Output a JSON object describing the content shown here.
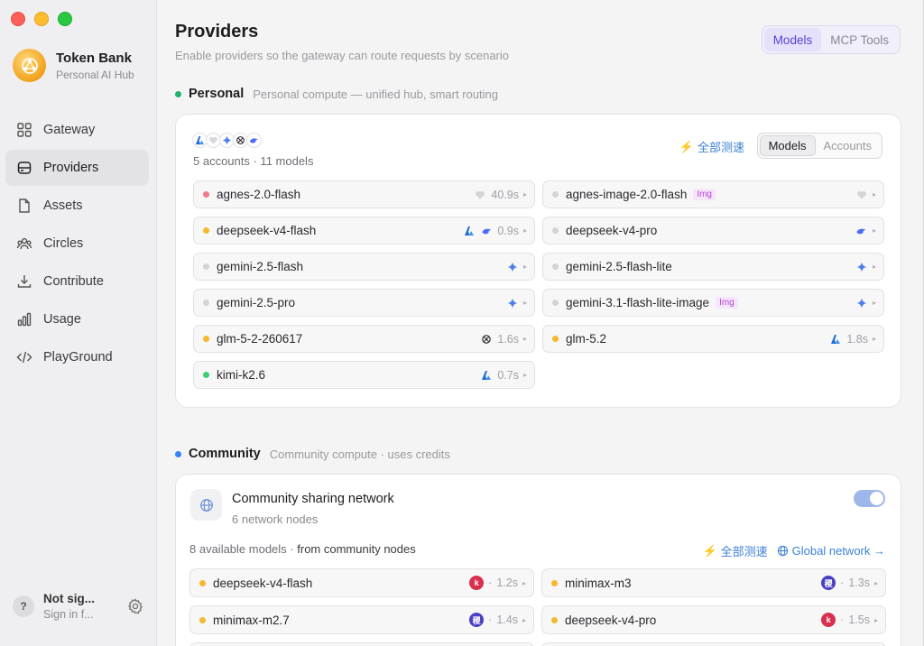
{
  "app": {
    "name": "Token Bank",
    "subtitle": "Personal AI Hub"
  },
  "nav": [
    {
      "label": "Gateway",
      "icon": "grid-icon",
      "active": false
    },
    {
      "label": "Providers",
      "icon": "server-icon",
      "active": true
    },
    {
      "label": "Assets",
      "icon": "document-icon",
      "active": false
    },
    {
      "label": "Circles",
      "icon": "people-icon",
      "active": false
    },
    {
      "label": "Contribute",
      "icon": "download-icon",
      "active": false
    },
    {
      "label": "Usage",
      "icon": "bar-chart-icon",
      "active": false
    },
    {
      "label": "PlayGround",
      "icon": "code-icon",
      "active": false
    }
  ],
  "user": {
    "avatar": "?",
    "name": "Not sig...",
    "sub": "Sign in f..."
  },
  "header": {
    "title": "Providers",
    "subtitle": "Enable providers so the gateway can route requests by scenario"
  },
  "top_tabs": {
    "models": "Models",
    "mcp": "MCP Tools",
    "active": "models"
  },
  "personal": {
    "title": "Personal",
    "desc": "Personal compute — unified hub, smart routing",
    "accounts_summary": "5 accounts · 11 models",
    "test_all": "全部测速",
    "tabs": {
      "models": "Models",
      "accounts": "Accounts",
      "active": "models"
    },
    "models": [
      {
        "name": "agnes-2.0-flash",
        "status": "error",
        "tag": "",
        "icons": [
          "heart"
        ],
        "latency": "40.9s"
      },
      {
        "name": "agnes-image-2.0-flash",
        "status": "idle",
        "tag": "Img",
        "icons": [
          "heart"
        ],
        "latency": ""
      },
      {
        "name": "deepseek-v4-flash",
        "status": "warn",
        "tag": "",
        "icons": [
          "azure",
          "deepseek"
        ],
        "latency": "0.9s"
      },
      {
        "name": "deepseek-v4-pro",
        "status": "idle",
        "tag": "",
        "icons": [
          "deepseek"
        ],
        "latency": ""
      },
      {
        "name": "gemini-2.5-flash",
        "status": "idle",
        "tag": "",
        "icons": [
          "gemini"
        ],
        "latency": ""
      },
      {
        "name": "gemini-2.5-flash-lite",
        "status": "idle",
        "tag": "",
        "icons": [
          "gemini"
        ],
        "latency": ""
      },
      {
        "name": "gemini-2.5-pro",
        "status": "idle",
        "tag": "",
        "icons": [
          "gemini"
        ],
        "latency": ""
      },
      {
        "name": "gemini-3.1-flash-lite-image",
        "status": "idle",
        "tag": "Img",
        "icons": [
          "gemini"
        ],
        "latency": ""
      },
      {
        "name": "glm-5-2-260617",
        "status": "warn",
        "tag": "",
        "icons": [
          "openai"
        ],
        "latency": "1.6s"
      },
      {
        "name": "glm-5.2",
        "status": "warn",
        "tag": "",
        "icons": [
          "azure"
        ],
        "latency": "1.8s"
      },
      {
        "name": "kimi-k2.6",
        "status": "ok",
        "tag": "",
        "icons": [
          "azure"
        ],
        "latency": "0.7s"
      }
    ]
  },
  "community": {
    "title": "Community",
    "desc": "Community compute · uses credits",
    "network_title": "Community sharing network",
    "network_sub": "6 network nodes",
    "enabled": true,
    "available_count": "8 available models",
    "available_source": "from community nodes",
    "test_all": "全部测速",
    "global_network": "Global network →",
    "models": [
      {
        "name": "deepseek-v4-flash",
        "status": "warn",
        "badge": "k",
        "badge_color": "#d9304f",
        "latency": "1.2s"
      },
      {
        "name": "minimax-m3",
        "status": "warn",
        "badge": "稷",
        "badge_color": "#4a3fc4",
        "latency": "1.3s"
      },
      {
        "name": "minimax-m2.7",
        "status": "warn",
        "badge": "稷",
        "badge_color": "#4a3fc4",
        "latency": "1.4s"
      },
      {
        "name": "deepseek-v4-pro",
        "status": "warn",
        "badge": "k",
        "badge_color": "#d9304f",
        "latency": "1.5s"
      },
      {
        "name": "",
        "status": "none",
        "badge": "",
        "badge_color": "",
        "latency": ""
      },
      {
        "name": "",
        "status": "none",
        "badge": "",
        "badge_color": "",
        "latency": ""
      }
    ]
  },
  "colors": {
    "status_ok": "#3ecf6e",
    "status_warn": "#f5b82e",
    "status_error": "#f07a84",
    "status_idle": "#d4d4d8",
    "accent": "#5b3fd6",
    "link": "#3b82d6",
    "personal_dot": "#22b36b",
    "community_dot": "#3b82f6"
  }
}
